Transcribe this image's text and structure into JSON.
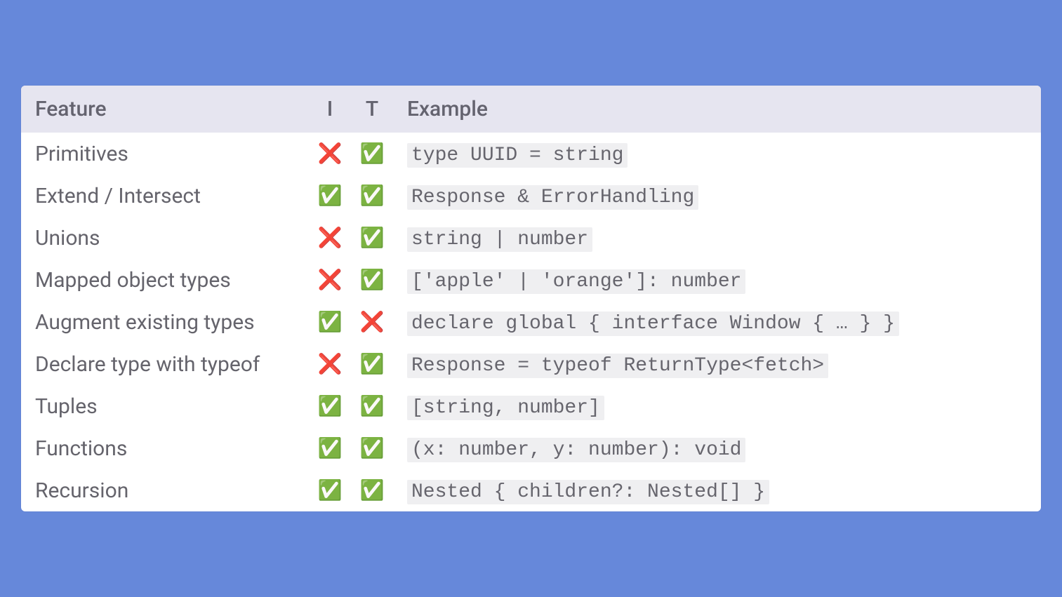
{
  "table": {
    "headers": {
      "feature": "Feature",
      "i": "I",
      "t": "T",
      "example": "Example"
    },
    "rows": [
      {
        "feature": "Primitives",
        "i": "❌",
        "t": "✅",
        "example": "type UUID = string"
      },
      {
        "feature": "Extend / Intersect",
        "i": "✅",
        "t": "✅",
        "example": "Response & ErrorHandling"
      },
      {
        "feature": "Unions",
        "i": "❌",
        "t": "✅",
        "example": "string | number"
      },
      {
        "feature": "Mapped object types",
        "i": "❌",
        "t": "✅",
        "example": "['apple' | 'orange']: number"
      },
      {
        "feature": "Augment existing types",
        "i": "✅",
        "t": "❌",
        "example": "declare global { interface Window { … } }"
      },
      {
        "feature": "Declare type with typeof",
        "i": "❌",
        "t": "✅",
        "example": "Response = typeof ReturnType<fetch>"
      },
      {
        "feature": "Tuples",
        "i": "✅",
        "t": "✅",
        "example": "[string, number]"
      },
      {
        "feature": "Functions",
        "i": "✅",
        "t": "✅",
        "example": "(x: number, y: number): void"
      },
      {
        "feature": "Recursion",
        "i": "✅",
        "t": "✅",
        "example": "Nested { children?: Nested[] }"
      }
    ]
  }
}
